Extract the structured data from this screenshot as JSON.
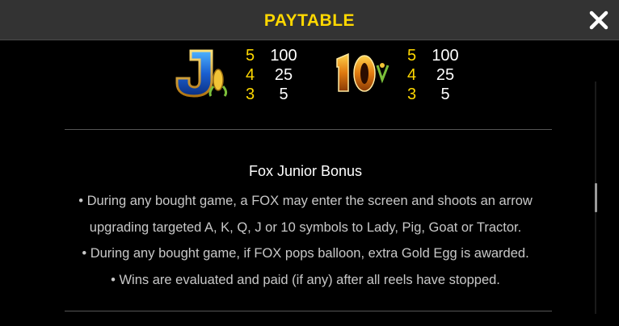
{
  "header": {
    "title": "PAYTABLE"
  },
  "symbols": [
    {
      "icon": "letter-j-symbol-icon",
      "pays": [
        {
          "count": "5",
          "value": "100"
        },
        {
          "count": "4",
          "value": "25"
        },
        {
          "count": "3",
          "value": "5"
        }
      ]
    },
    {
      "icon": "ten-symbol-icon",
      "pays": [
        {
          "count": "5",
          "value": "100"
        },
        {
          "count": "4",
          "value": "25"
        },
        {
          "count": "3",
          "value": "5"
        }
      ]
    }
  ],
  "bonus": {
    "title": "Fox Junior Bonus",
    "lines": [
      "• During any bought game, a FOX may enter the screen and shoots an arrow",
      "upgrading targeted A, K, Q, J or 10 symbols to Lady, Pig, Goat or Tractor.",
      "• During any bought game, if FOX pops balloon, extra Gold Egg is awarded.",
      "• Wins are evaluated and paid (if any) after all reels have stopped."
    ]
  },
  "colors": {
    "accent": "#ffd800",
    "header_bg": "#333333",
    "text": "#ffffff"
  }
}
